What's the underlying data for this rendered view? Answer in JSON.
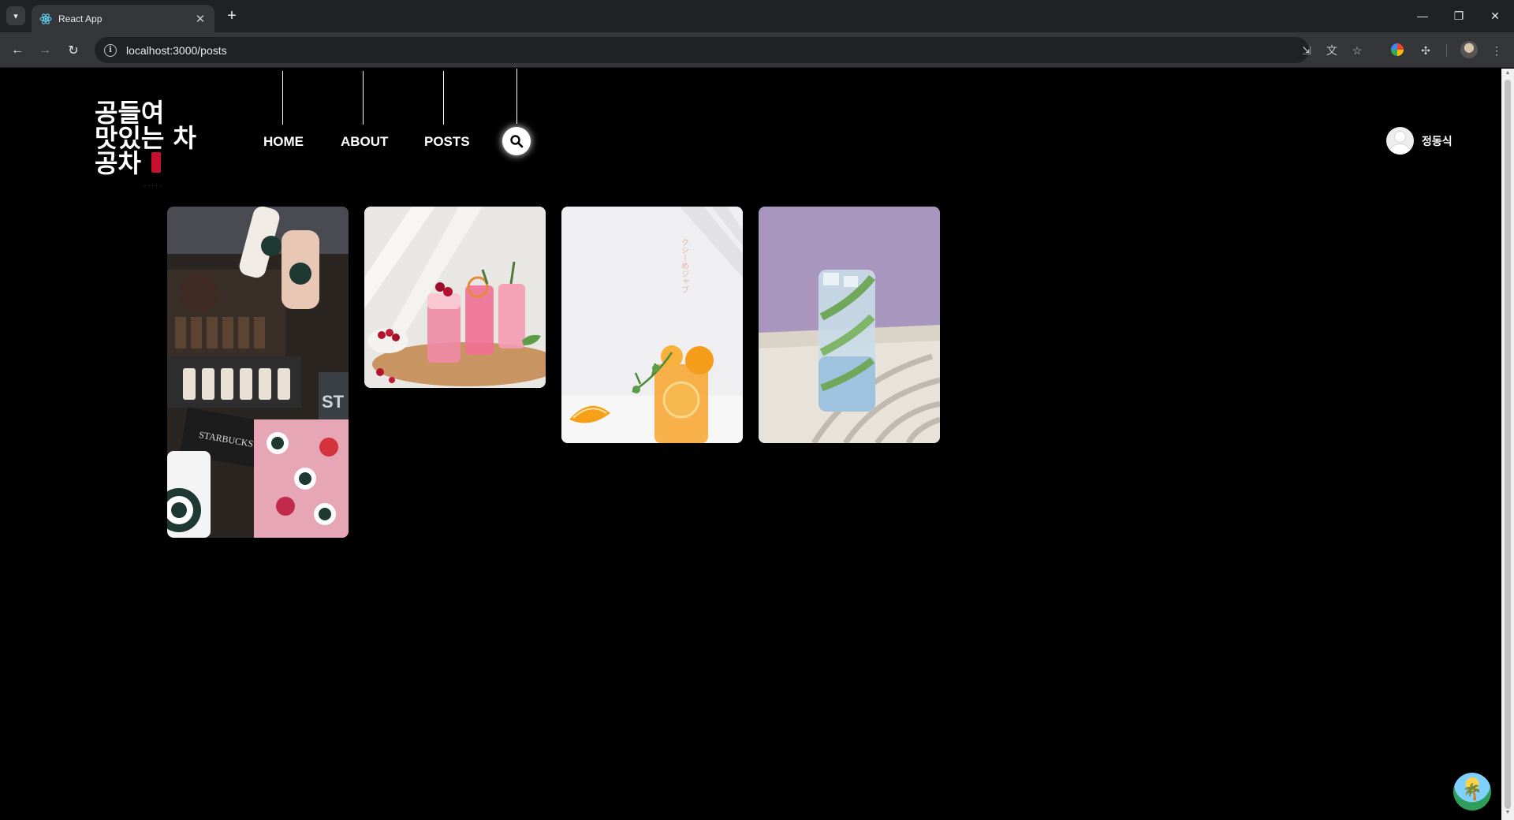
{
  "browser": {
    "tab_title": "React App",
    "url": "localhost:3000/posts",
    "icons": {
      "tab_search": "chevron-down-icon",
      "new_tab": "plus-icon",
      "back": "arrow-left-icon",
      "forward": "arrow-right-icon",
      "reload": "reload-icon",
      "site_info": "info-icon",
      "install": "install-app-icon",
      "translate": "translate-icon",
      "bookmark": "star-icon",
      "extensions": "puzzle-icon",
      "menu": "kebab-menu-icon"
    }
  },
  "site": {
    "logo_lines": [
      "공들여",
      "맛있는 차",
      "공차"
    ],
    "nav": {
      "home": "HOME",
      "about": "ABOUT",
      "posts": "POSTS"
    },
    "user_name": "정동식"
  },
  "posts": {
    "cards": [
      {
        "alt": "Starbucks collage",
        "accent": "#1e3932"
      },
      {
        "alt": "Pink berry drinks",
        "accent": "#e8557a"
      },
      {
        "alt": "Orange ade",
        "accent": "#f5a31a"
      },
      {
        "alt": "Cucumber soda",
        "accent": "#9d8ab3"
      }
    ],
    "card3_vertical_text": "クシーめジャブ"
  },
  "colors": {
    "page_background": "#000000",
    "nav_text": "#ffffff",
    "logo_seal": "#c8102e"
  }
}
